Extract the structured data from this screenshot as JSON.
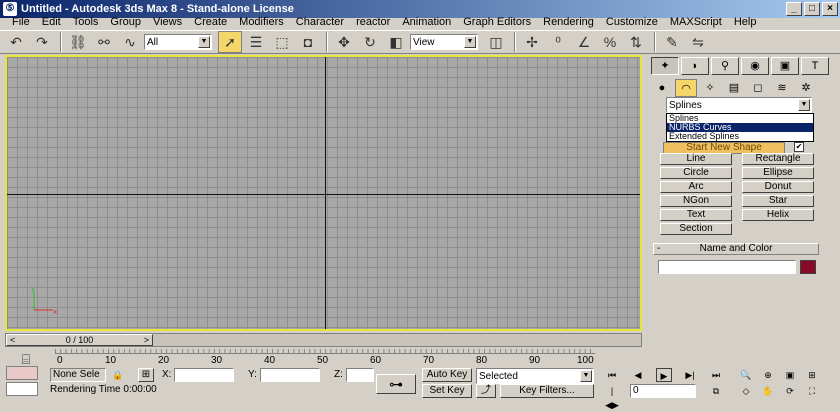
{
  "window": {
    "title": "Untitled - Autodesk 3ds Max 8 - Stand-alone License"
  },
  "menu": [
    "File",
    "Edit",
    "Tools",
    "Group",
    "Views",
    "Create",
    "Modifiers",
    "Character",
    "reactor",
    "Animation",
    "Graph Editors",
    "Rendering",
    "Customize",
    "MAXScript",
    "Help"
  ],
  "toolbar": {
    "selection_filter": "All",
    "ref_coord": "View"
  },
  "command_panel": {
    "category_selected": "Splines",
    "category_options": [
      "Splines",
      "NURBS Curves",
      "Extended Splines"
    ],
    "highlighted_option": "NURBS Curves",
    "start_new_shape": "Start New Shape",
    "start_new_checked": "✔",
    "shape_buttons": [
      "Line",
      "Rectangle",
      "Circle",
      "Ellipse",
      "Arc",
      "Donut",
      "NGon",
      "Star",
      "Text",
      "Helix",
      "Section"
    ],
    "name_and_color": "Name and Color",
    "rollout_minus": "-"
  },
  "timeline": {
    "frame_label": "0 / 100",
    "prev": "<",
    "next": ">",
    "ticks": [
      "0",
      "10",
      "20",
      "30",
      "40",
      "50",
      "60",
      "70",
      "80",
      "90",
      "100"
    ]
  },
  "status": {
    "selection": "None Sele",
    "x_label": "X:",
    "y_label": "Y:",
    "z_label": "Z:",
    "rendering_time": "Rendering Time  0:00:00",
    "auto_key": "Auto Key",
    "set_key": "Set Key",
    "key_mode_selected": "Selected",
    "key_filters": "Key Filters...",
    "frame": "0"
  }
}
